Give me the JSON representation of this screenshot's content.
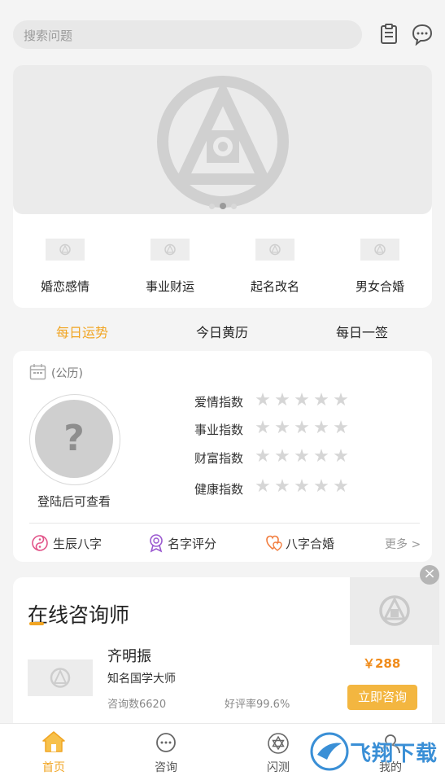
{
  "search": {
    "placeholder": "搜索问题"
  },
  "header_icons": [
    "clipboard-icon",
    "chat-icon"
  ],
  "categories": [
    {
      "label": "婚恋感情"
    },
    {
      "label": "事业财运"
    },
    {
      "label": "起名改名"
    },
    {
      "label": "男女合婚"
    }
  ],
  "tabs": [
    {
      "label": "每日运势",
      "active": true
    },
    {
      "label": "今日黄历",
      "active": false
    },
    {
      "label": "每日一签",
      "active": false
    }
  ],
  "fortune": {
    "calendar_label": "(公历)",
    "avatar_symbol": "?",
    "login_hint": "登陆后可查看",
    "indices": [
      {
        "label": "爱情指数",
        "stars": 0
      },
      {
        "label": "事业指数",
        "stars": 0
      },
      {
        "label": "财富指数",
        "stars": 0
      },
      {
        "label": "健康指数",
        "stars": 0
      }
    ],
    "tools": [
      {
        "label": "生辰八字",
        "icon": "yin-yang-icon"
      },
      {
        "label": "名字评分",
        "icon": "medal-icon"
      },
      {
        "label": "八字合婚",
        "icon": "hearts-icon"
      }
    ],
    "more": "更多 >"
  },
  "consult": {
    "title": "在线咨询师",
    "name": "齐明振",
    "subtitle": "知名国学大师",
    "count": "咨询数6620",
    "rating": "好评率99.6%",
    "price": "￥288",
    "button": "立即咨询",
    "close": "×"
  },
  "bottom_nav": [
    {
      "label": "首页",
      "active": true,
      "icon": "home-icon"
    },
    {
      "label": "咨询",
      "active": false,
      "icon": "chat-bubble-icon"
    },
    {
      "label": "闪测",
      "active": false,
      "icon": "star-of-david-icon"
    },
    {
      "label": "我的",
      "active": false,
      "icon": "user-icon"
    }
  ],
  "watermark": "飞翔下载",
  "colors": {
    "accent": "#f1a523",
    "price": "#f08b1a",
    "button": "#f3b640"
  }
}
